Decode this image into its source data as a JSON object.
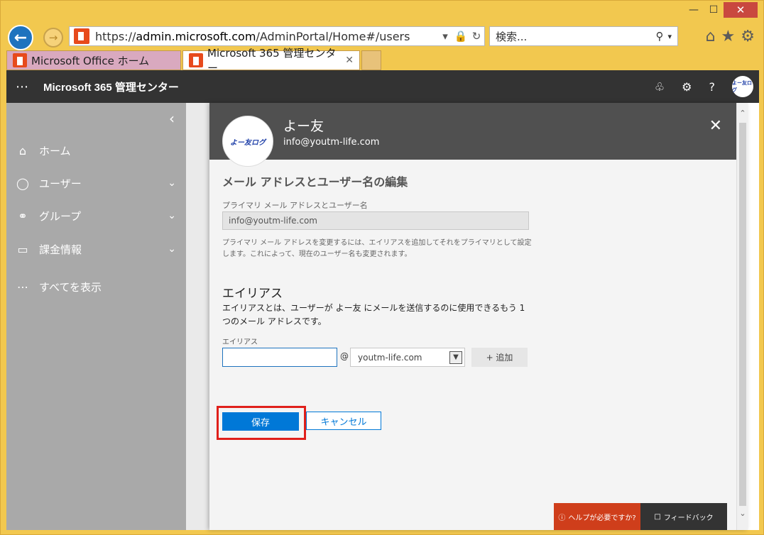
{
  "browser": {
    "url_prefix": "https://",
    "url_domain": "admin.microsoft.com",
    "url_path": "/AdminPortal/Home#/users",
    "search_placeholder": "検索...",
    "tabs": [
      {
        "label": "Microsoft Office ホーム"
      },
      {
        "label": "Microsoft 365 管理センター..."
      }
    ]
  },
  "app": {
    "title": "Microsoft 365 管理センター",
    "avatar_text": "よー友ログ"
  },
  "sidebar": {
    "items": [
      {
        "label": "ホーム",
        "icon": "home-icon"
      },
      {
        "label": "ユーザー",
        "icon": "user-icon"
      },
      {
        "label": "グループ",
        "icon": "group-icon"
      },
      {
        "label": "課金情報",
        "icon": "billing-icon"
      },
      {
        "label": "すべてを表示",
        "icon": "more-icon"
      }
    ]
  },
  "panel": {
    "user_name": "よー友",
    "user_email": "info@youtm-life.com",
    "avatar_text": "よー友ログ",
    "section_title": "メール アドレスとユーザー名の編集",
    "primary_label": "プライマリ メール アドレスとユーザー名",
    "primary_value": "info@youtm-life.com",
    "note": "プライマリ メール アドレスを変更するには、エイリアスを追加してそれをプライマリとして設定します。これによって、現在のユーザー名も変更されます。",
    "alias_title": "エイリアス",
    "alias_desc": "エイリアスとは、ユーザーが よー友 にメールを送信するのに使用できるもう 1 つのメール アドレスです。",
    "alias_label": "エイリアス",
    "alias_value": "",
    "at": "@",
    "domain": "youtm-life.com",
    "add_label": "+ 追加",
    "save_label": "保存",
    "cancel_label": "キャンセル",
    "help_label": "ヘルプが必要ですか?",
    "feedback_label": "フィードバック"
  },
  "colors": {
    "accent": "#0078d7",
    "highlight": "#e0201b",
    "topbar": "#333333",
    "help": "#cf3e1b"
  }
}
